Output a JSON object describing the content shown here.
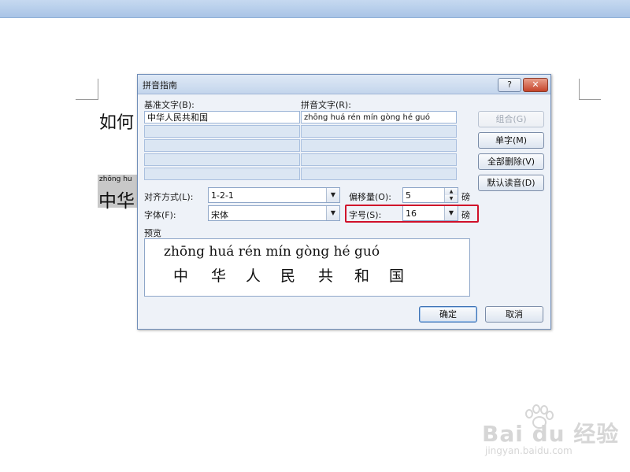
{
  "document": {
    "text_line1": "如何",
    "ruby_fragment": "zhōng hu",
    "base_fragment": "中华"
  },
  "dialog": {
    "title": "拼音指南",
    "help_glyph": "?",
    "close_glyph": "✕",
    "base_text_label": "基准文字(B):",
    "pinyin_text_label": "拼音文字(R):",
    "rows": [
      {
        "base": "中华人民共和国",
        "pinyin": "zhōng huá rén mín gòng hé guó"
      },
      {
        "base": "",
        "pinyin": ""
      },
      {
        "base": "",
        "pinyin": ""
      },
      {
        "base": "",
        "pinyin": ""
      },
      {
        "base": "",
        "pinyin": ""
      }
    ],
    "buttons": {
      "combine": "组合(G)",
      "single": "单字(M)",
      "delete_all": "全部删除(V)",
      "default_reading": "默认读音(D)",
      "ok": "确定",
      "cancel": "取消"
    },
    "alignment_label": "对齐方式(L):",
    "alignment_value": "1-2-1",
    "offset_label": "偏移量(O):",
    "offset_value": "5",
    "offset_unit": "磅",
    "font_label": "字体(F):",
    "font_value": "宋体",
    "size_label": "字号(S):",
    "size_value": "16",
    "size_unit": "磅",
    "preview_label": "预览",
    "preview_pinyin": "zhōng huá rén mín gòng hé guó",
    "preview_chars": [
      "中",
      "华",
      "人",
      "民",
      "共",
      "和",
      "国"
    ]
  },
  "watermark": {
    "brand": "Bai du 经验",
    "url": "jingyan.baidu.com"
  },
  "colors": {
    "highlight": "#d0102a",
    "dialog_bg": "#eef2f8"
  }
}
